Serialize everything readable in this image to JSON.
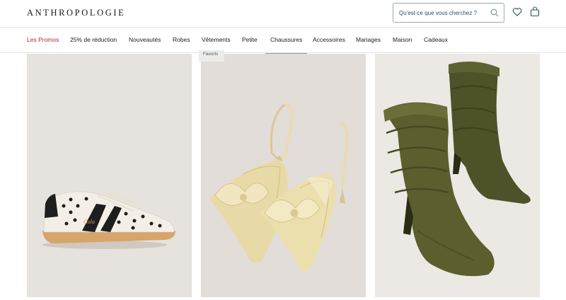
{
  "header": {
    "logo": "ANTHROPOLOGIE",
    "search_placeholder": "Qu'est-ce que vous cherchez ?",
    "icons": [
      "search-icon",
      "heart-icon",
      "shopping-bag-icon"
    ]
  },
  "nav": {
    "items": [
      {
        "label": "Les Promos"
      },
      {
        "label": "25% de réduction"
      },
      {
        "label": "Nouveautés"
      },
      {
        "label": "Robes"
      },
      {
        "label": "Vêtements"
      },
      {
        "label": "Petite"
      },
      {
        "label": "Chaussures"
      },
      {
        "label": "Accessoires"
      },
      {
        "label": "Mariages"
      },
      {
        "label": "Maison"
      },
      {
        "label": "Cadeaux"
      }
    ],
    "active": "Chaussures",
    "promo_color": "#b3282d"
  },
  "products": [
    {
      "badge": "",
      "shoe_brand": "Gola"
    },
    {
      "badge": "Favoris",
      "shoe_brand": ""
    },
    {
      "badge": "",
      "shoe_brand": ""
    }
  ]
}
